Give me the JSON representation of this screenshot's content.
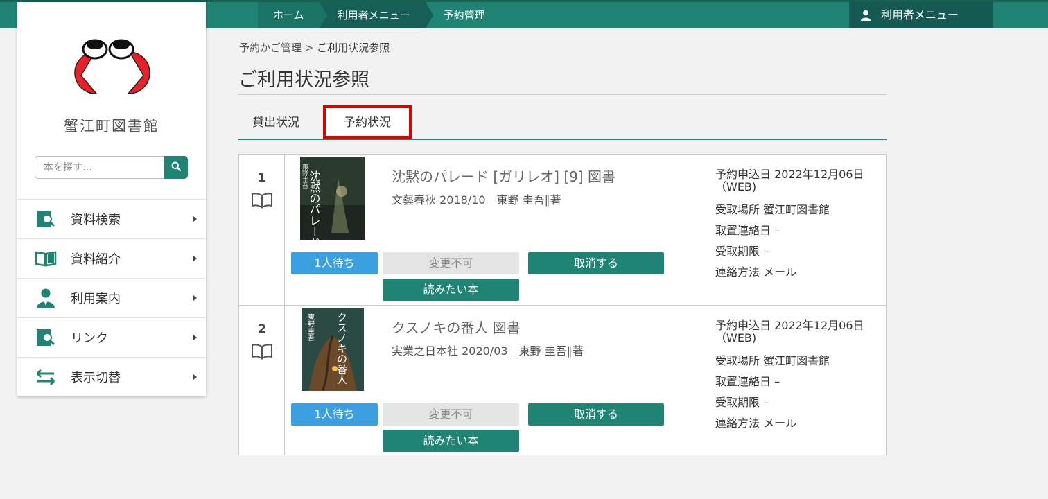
{
  "topbar": {
    "crumbs": [
      "ホーム",
      "利用者メニュー",
      "予約管理"
    ],
    "user_menu_label": "利用者メニュー"
  },
  "sidebar": {
    "library_name": "蟹江町図書館",
    "search_placeholder": "本を探す…",
    "nav_items": [
      {
        "label": "資料検索",
        "icon": "search-document-icon"
      },
      {
        "label": "資料紹介",
        "icon": "open-book-icon"
      },
      {
        "label": "利用案内",
        "icon": "person-icon"
      },
      {
        "label": "リンク",
        "icon": "search-document-icon"
      },
      {
        "label": "表示切替",
        "icon": "switch-arrows-icon"
      }
    ]
  },
  "main": {
    "breadcrumb": {
      "parent": "予約かご管理",
      "sep": ">",
      "current": "ご利用状況参照"
    },
    "page_title": "ご利用状況参照",
    "tabs": [
      {
        "label": "貸出状況",
        "active": false
      },
      {
        "label": "予約状況",
        "active": true
      }
    ],
    "reservations": [
      {
        "number": "1",
        "title": "沈黙のパレード [ガリレオ] [9] 図書",
        "meta": "文藝春秋 2018/10　東野 圭吾∥著",
        "wait_label": "1人待ち",
        "nochange_label": "変更不可",
        "cancel_label": "取消する",
        "want_label": "読みたい本",
        "apply_date": "予約申込日 2022年12月06日",
        "apply_via": "（WEB)",
        "pickup_place": "受取場所 蟹江町図書館",
        "hold_notice": "取置連絡日 –",
        "pickup_deadline": "受取期限 –",
        "contact": "連絡方法 メール",
        "cover_text": "沈黙のパレード",
        "cover_author": "東野圭吾"
      },
      {
        "number": "2",
        "title": "クスノキの番人 図書",
        "meta": "実業之日本社 2020/03　東野 圭吾∥著",
        "wait_label": "1人待ち",
        "nochange_label": "変更不可",
        "cancel_label": "取消する",
        "want_label": "読みたい本",
        "apply_date": "予約申込日 2022年12月06日",
        "apply_via": "（WEB)",
        "pickup_place": "受取場所 蟹江町図書館",
        "hold_notice": "取置連絡日 –",
        "pickup_deadline": "受取期限 –",
        "contact": "連絡方法 メール",
        "cover_text": "クスノキの番人",
        "cover_author": "東野圭吾"
      }
    ]
  },
  "colors": {
    "brand": "#1f8474",
    "highlight": "#e00000",
    "wait": "#3aa0e0"
  }
}
